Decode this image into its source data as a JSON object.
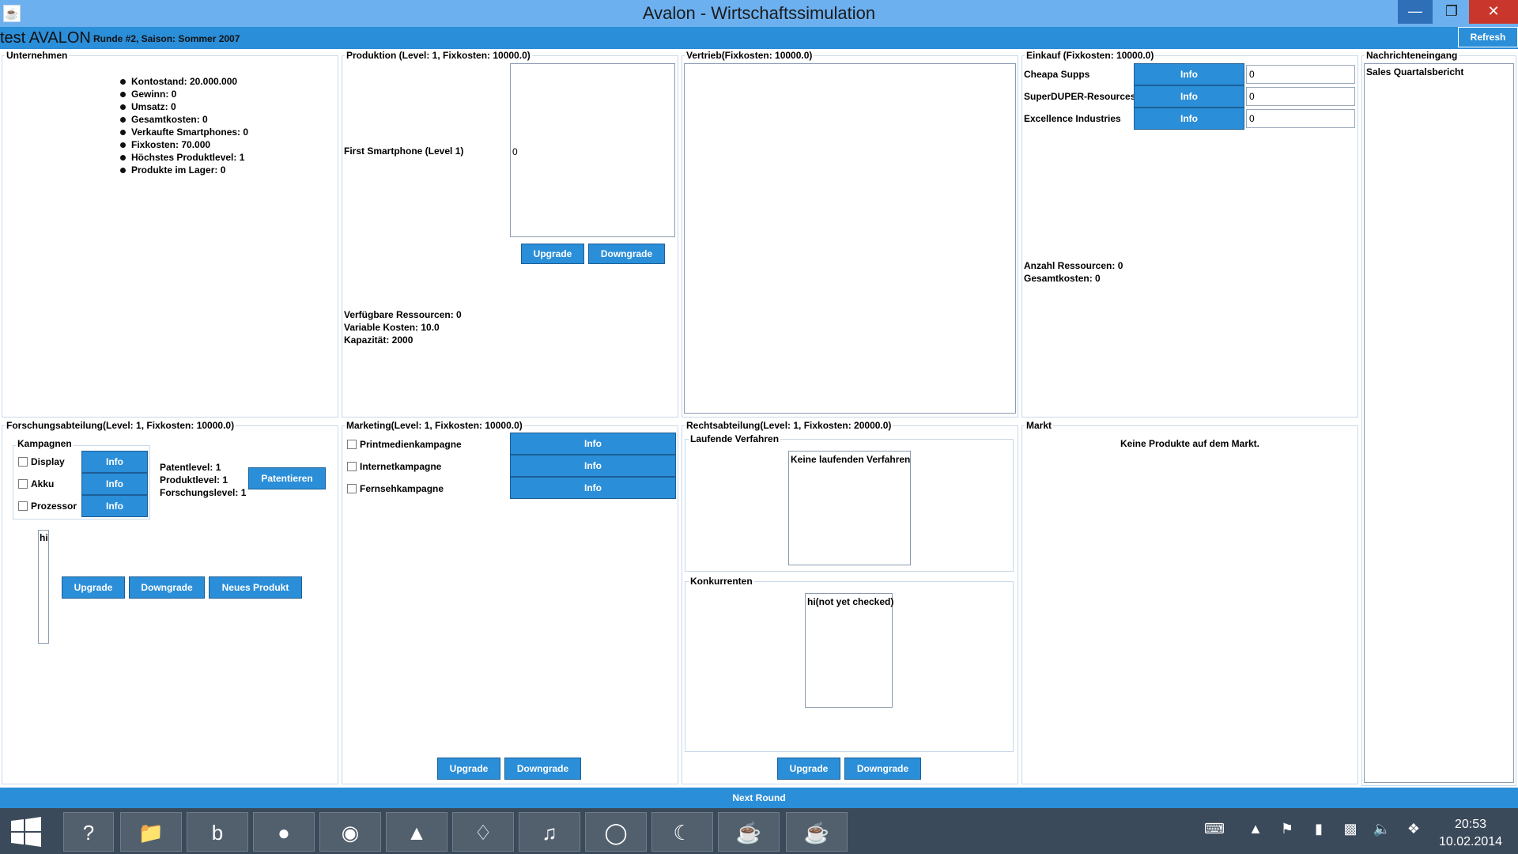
{
  "window": {
    "title": "Avalon - Wirtschaftssimulation"
  },
  "header": {
    "game_name": "test AVALON",
    "round_info": "Runde #2, Saison: Sommer 2007",
    "refresh_label": "Refresh"
  },
  "unternehmen": {
    "title": "Unternehmen",
    "stats": [
      "Kontostand: 20.000.000",
      "Gewinn: 0",
      "Umsatz: 0",
      "Gesamtkosten: 0",
      "Verkaufte Smartphones: 0",
      "Fixkosten: 70.000",
      "Höchstes Produktlevel: 1",
      "Produkte im Lager: 0"
    ]
  },
  "produktion": {
    "title": "Produktion (Level: 1, Fixkosten: 10000.0)",
    "product_label": "First Smartphone (Level 1)",
    "product_value": "0",
    "upgrade_label": "Upgrade",
    "downgrade_label": "Downgrade",
    "info_lines": [
      "Verfügbare Ressourcen: 0",
      "Variable Kosten: 10.0",
      "Kapazität: 2000"
    ]
  },
  "vertrieb": {
    "title": "Vertrieb(Fixkosten: 10000.0)"
  },
  "einkauf": {
    "title": "Einkauf (Fixkosten: 10000.0)",
    "suppliers": [
      {
        "name": "Cheapa Supps",
        "info": "Info",
        "value": "0"
      },
      {
        "name": "SuperDUPER-Resources",
        "info": "Info",
        "value": "0"
      },
      {
        "name": "Excellence Industries",
        "info": "Info",
        "value": "0"
      }
    ],
    "summary": [
      "Anzahl Ressourcen: 0",
      "Gesamtkosten: 0"
    ]
  },
  "nachrichten": {
    "title": "Nachrichteneingang",
    "items": [
      "Sales Quartalsbericht"
    ]
  },
  "forschung": {
    "title": "Forschungsabteilung(Level: 1, Fixkosten: 10000.0)",
    "kampagnen_title": "Kampagnen",
    "kampagnen": [
      {
        "label": "Display",
        "info": "Info"
      },
      {
        "label": "Akku",
        "info": "Info"
      },
      {
        "label": "Prozessor",
        "info": "Info"
      }
    ],
    "levels": [
      "Patentlevel: 1",
      "Produktlevel: 1",
      "Forschungslevel: 1"
    ],
    "patent_button": "Patentieren",
    "list_item": "hi",
    "upgrade_label": "Upgrade",
    "downgrade_label": "Downgrade",
    "new_product_label": "Neues Produkt"
  },
  "marketing": {
    "title": "Marketing(Level: 1, Fixkosten: 10000.0)",
    "kampagnen": [
      {
        "label": "Printmedienkampagne",
        "info": "Info"
      },
      {
        "label": "Internetkampagne",
        "info": "Info"
      },
      {
        "label": "Fernsehkampagne",
        "info": "Info"
      }
    ],
    "upgrade_label": "Upgrade",
    "downgrade_label": "Downgrade"
  },
  "recht": {
    "title": "Rechtsabteilung(Level: 1, Fixkosten: 20000.0)",
    "verfahren_title": "Laufende Verfahren",
    "verfahren_item": "Keine laufenden Verfahren",
    "konkurrenten_title": "Konkurrenten",
    "konkurrenten_item": "hi(not yet checked)",
    "upgrade_label": "Upgrade",
    "downgrade_label": "Downgrade"
  },
  "markt": {
    "title": "Markt",
    "message": "Keine Produkte auf dem Markt."
  },
  "footer": {
    "next_round_label": "Next Round"
  },
  "taskbar": {
    "apps": [
      "windows-start-icon",
      "help-icon",
      "file-explorer-icon",
      "bing-icon",
      "firefox-icon",
      "chrome-icon",
      "package-icon",
      "acrobat-icon",
      "itunes-icon",
      "chat-icon",
      "eclipse-icon",
      "java-icon",
      "java-icon"
    ],
    "time": "20:53",
    "date": "10.02.2014"
  },
  "colors": {
    "accent": "#2b8ed8",
    "titlebar": "#6cb0ef",
    "close": "#c9372c"
  }
}
